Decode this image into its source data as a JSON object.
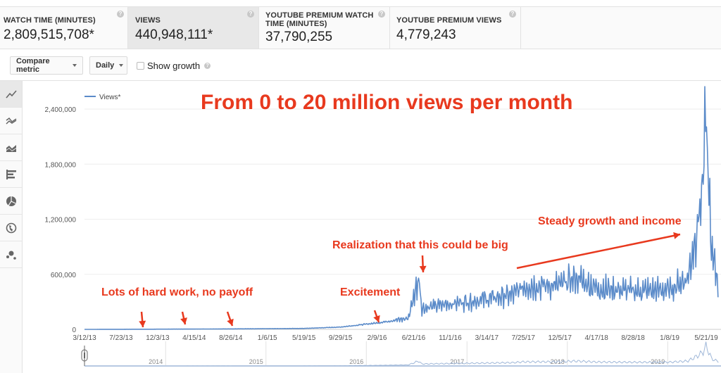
{
  "metrics": [
    {
      "label": "WATCH TIME (MINUTES)",
      "value": "2,809,515,708*",
      "selected": false
    },
    {
      "label": "VIEWS",
      "value": "440,948,111*",
      "selected": true
    },
    {
      "label": "YOUTUBE PREMIUM WATCH TIME (MINUTES)",
      "value": "37,790,255",
      "selected": false
    },
    {
      "label": "YOUTUBE PREMIUM VIEWS",
      "value": "4,779,243",
      "selected": false
    }
  ],
  "help_icon_glyph": "?",
  "toolbar": {
    "compare_metric_label": "Compare metric",
    "interval_label": "Daily",
    "show_growth_label": "Show growth",
    "show_growth_checked": false
  },
  "sidebar": {
    "chart_types": [
      {
        "name": "line-chart",
        "active": true
      },
      {
        "name": "multi-line-chart",
        "active": false
      },
      {
        "name": "stacked-area-chart",
        "active": false
      },
      {
        "name": "bar-chart",
        "active": false
      },
      {
        "name": "pie-chart",
        "active": false
      },
      {
        "name": "map-chart",
        "active": false
      },
      {
        "name": "bubble-chart",
        "active": false
      }
    ]
  },
  "chart_data": {
    "type": "line",
    "title": "From 0 to 20 million views per month",
    "legend": {
      "entries": [
        "Views*"
      ],
      "placement": "top-left"
    },
    "series_color": "#5b8bc9",
    "annotation_color": "#e8391e",
    "xlabel": "",
    "ylabel": "",
    "ylim": [
      0,
      2400000
    ],
    "yticks": [
      0,
      600000,
      1200000,
      1800000,
      2400000
    ],
    "ytick_labels": [
      "0",
      "600,000",
      "1,200,000",
      "1,800,000",
      "2,400,000"
    ],
    "grid": true,
    "xtick_labels": [
      "3/12/13",
      "7/23/13",
      "12/3/13",
      "4/15/14",
      "8/26/14",
      "1/6/15",
      "5/19/15",
      "9/29/15",
      "2/9/16",
      "6/21/16",
      "11/1/16",
      "3/14/17",
      "7/25/17",
      "12/5/17",
      "4/17/18",
      "8/28/18",
      "1/8/19",
      "5/21/19"
    ],
    "navigator_years": [
      "2014",
      "2015",
      "2016",
      "2017",
      "2018",
      "2019"
    ],
    "series": [
      {
        "name": "Views*",
        "note": "approximate daily views read from the chart at key dates",
        "x": [
          "3/12/13",
          "12/3/13",
          "8/26/14",
          "5/19/15",
          "9/29/15",
          "2/9/16",
          "6/1/16",
          "7/10/16",
          "7/20/16",
          "11/1/16",
          "3/14/17",
          "6/20/17",
          "7/25/17",
          "12/5/17",
          "2/1/18",
          "4/17/18",
          "8/28/18",
          "1/8/19",
          "3/15/19",
          "4/20/19",
          "5/10/19",
          "5/21/19",
          "6/10/19",
          "7/5/19"
        ],
        "values": [
          0,
          2000,
          5000,
          10000,
          25000,
          70000,
          120000,
          570000,
          230000,
          280000,
          330000,
          380000,
          470000,
          480000,
          560000,
          450000,
          420000,
          430000,
          560000,
          1150000,
          1600000,
          2280000,
          800000,
          500000
        ]
      }
    ],
    "annotations": [
      {
        "text": "From 0 to 20 million views per month",
        "role": "headline"
      },
      {
        "text": "Lots of hard work, no payoff",
        "arrows_at": [
          "12/3/13",
          "4/15/14",
          "8/26/14"
        ]
      },
      {
        "text": "Excitement",
        "arrows_at": [
          "2/9/16"
        ]
      },
      {
        "text": "Realization that this could be big",
        "arrows_at": [
          "7/10/16"
        ]
      },
      {
        "text": "Steady growth and income",
        "arrow": "trend from 7/25/17 to 4/20/19"
      }
    ]
  }
}
